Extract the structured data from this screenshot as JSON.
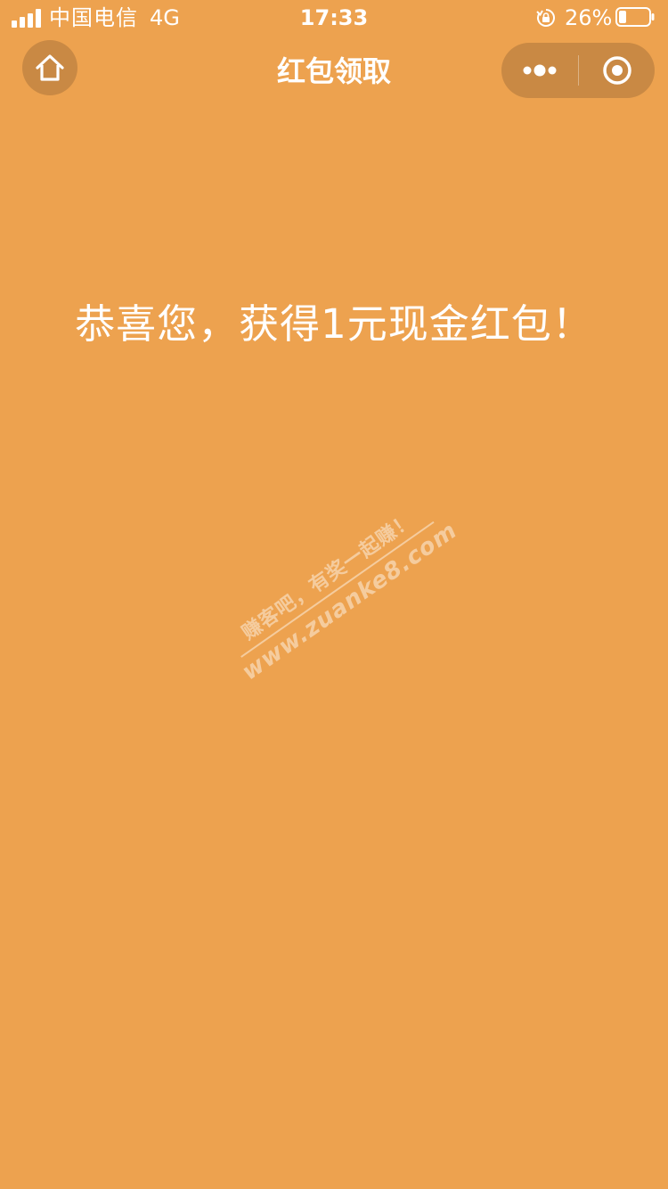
{
  "status_bar": {
    "carrier": "中国电信",
    "network": "4G",
    "time": "17:33",
    "battery_percent": "26%",
    "battery_level": 0.26,
    "signal_icon": "signal-icon",
    "lock_icon": "rotation-lock-icon",
    "battery_icon": "battery-icon"
  },
  "nav": {
    "title": "红包领取",
    "home_icon": "home-icon",
    "more_icon": "more-dots-icon",
    "close_icon": "close-miniprogram-icon"
  },
  "main": {
    "message": "恭喜您，获得1元现金红包！"
  },
  "watermark": {
    "line1": "赚客吧，有奖一起赚！",
    "line2": "www.zuanke8.com"
  },
  "colors": {
    "background": "#EDA24F",
    "button_bg": "#C98944",
    "text": "#FFFFFF"
  }
}
